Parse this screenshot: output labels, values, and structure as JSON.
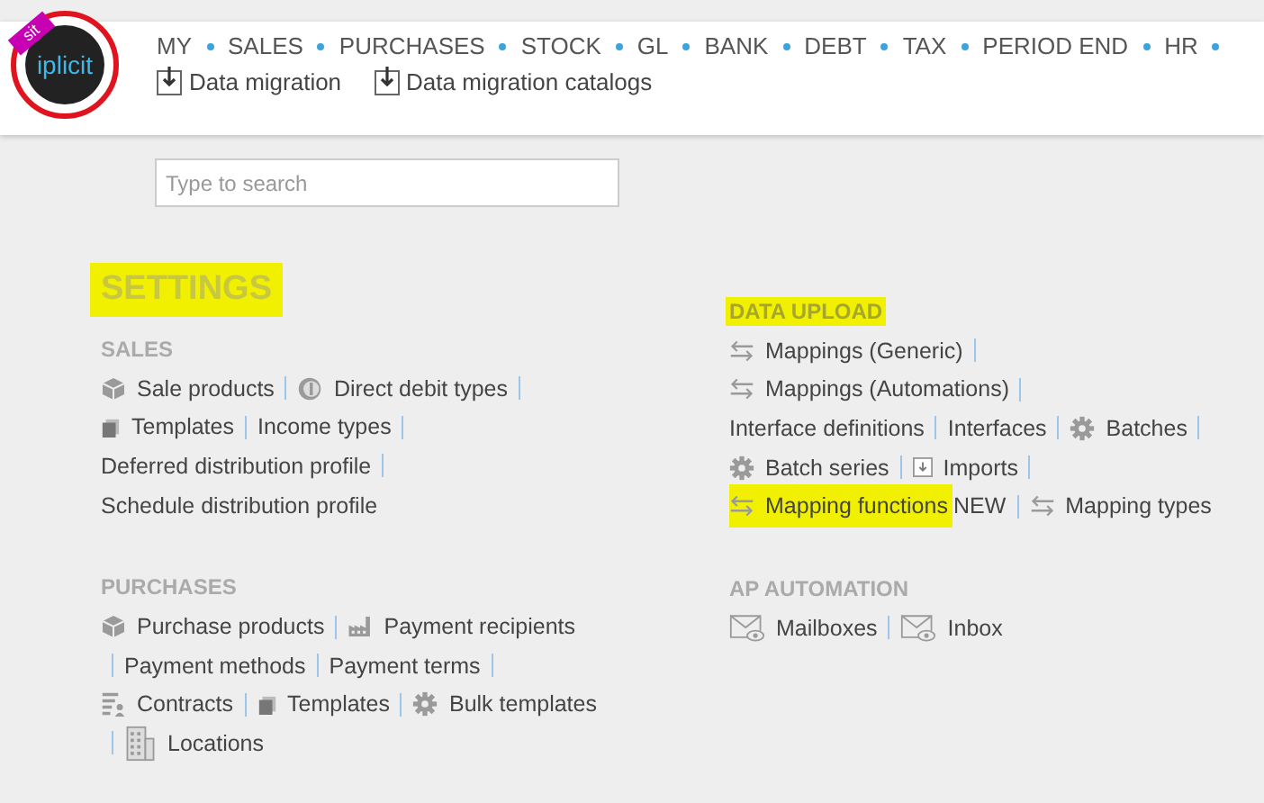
{
  "logo": {
    "text": "iplicit",
    "ribbon": "sit"
  },
  "nav": {
    "items": [
      "MY",
      "SALES",
      "PURCHASES",
      "STOCK",
      "GL",
      "BANK",
      "DEBT",
      "TAX",
      "PERIOD END",
      "HR"
    ]
  },
  "sub_links": [
    "Data migration",
    "Data migration catalogs"
  ],
  "search": {
    "placeholder": "Type to search"
  },
  "title": {
    "text": "SETTINGS",
    "highlighted": true
  },
  "columns": [
    [
      {
        "heading": "SALES",
        "highlighted": false,
        "lines": [
          [
            {
              "kind": "box",
              "text": "Sale products"
            },
            {
              "kind": "sep"
            },
            {
              "kind": "coin",
              "text": "Direct debit types"
            },
            {
              "kind": "sep"
            }
          ],
          [
            {
              "kind": "doc",
              "text": "Templates"
            },
            {
              "kind": "sep"
            },
            {
              "kind": "plain",
              "text": "Income types"
            },
            {
              "kind": "sep"
            }
          ],
          [
            {
              "kind": "plain",
              "text": "Deferred distribution profile"
            },
            {
              "kind": "sep"
            }
          ],
          [
            {
              "kind": "plain",
              "text": "Schedule distribution profile"
            }
          ]
        ]
      },
      {
        "heading": "PURCHASES",
        "highlighted": false,
        "lines": [
          [
            {
              "kind": "box",
              "text": "Purchase products"
            },
            {
              "kind": "sep"
            },
            {
              "kind": "factory",
              "text": "Payment recipients"
            }
          ],
          [
            {
              "kind": "sep"
            },
            {
              "kind": "plain",
              "text": "Payment methods"
            },
            {
              "kind": "sep"
            },
            {
              "kind": "plain",
              "text": "Payment terms"
            },
            {
              "kind": "sep"
            }
          ],
          [
            {
              "kind": "list",
              "text": "Contracts"
            },
            {
              "kind": "sep"
            },
            {
              "kind": "doc",
              "text": "Templates"
            },
            {
              "kind": "sep"
            },
            {
              "kind": "gear",
              "text": "Bulk templates"
            }
          ],
          [
            {
              "kind": "sep"
            },
            {
              "kind": "building",
              "text": "Locations"
            }
          ]
        ]
      }
    ],
    [
      {
        "heading": "DATA UPLOAD",
        "highlighted": true,
        "lines": [
          [
            {
              "kind": "arrows",
              "text": "Mappings (Generic)"
            },
            {
              "kind": "sep"
            }
          ],
          [
            {
              "kind": "arrows",
              "text": "Mappings (Automations)"
            },
            {
              "kind": "sep"
            }
          ],
          [
            {
              "kind": "plain",
              "text": "Interface definitions"
            },
            {
              "kind": "sep"
            },
            {
              "kind": "plain",
              "text": "Interfaces"
            },
            {
              "kind": "sep"
            },
            {
              "kind": "gear",
              "text": "Batches"
            },
            {
              "kind": "sep"
            }
          ],
          [
            {
              "kind": "gear",
              "text": "Batch series"
            },
            {
              "kind": "sep"
            },
            {
              "kind": "import",
              "text": "Imports"
            },
            {
              "kind": "sep"
            }
          ],
          [
            {
              "kind": "arrows",
              "text": "Mapping functions",
              "highlighted": true,
              "suffix": "NEW"
            },
            {
              "kind": "sep"
            },
            {
              "kind": "arrows",
              "text": "Mapping types"
            }
          ]
        ]
      },
      {
        "heading": "AP AUTOMATION",
        "highlighted": false,
        "lines": [
          [
            {
              "kind": "mail",
              "text": "Mailboxes"
            },
            {
              "kind": "sep"
            },
            {
              "kind": "mail",
              "text": "Inbox"
            }
          ]
        ]
      }
    ]
  ]
}
